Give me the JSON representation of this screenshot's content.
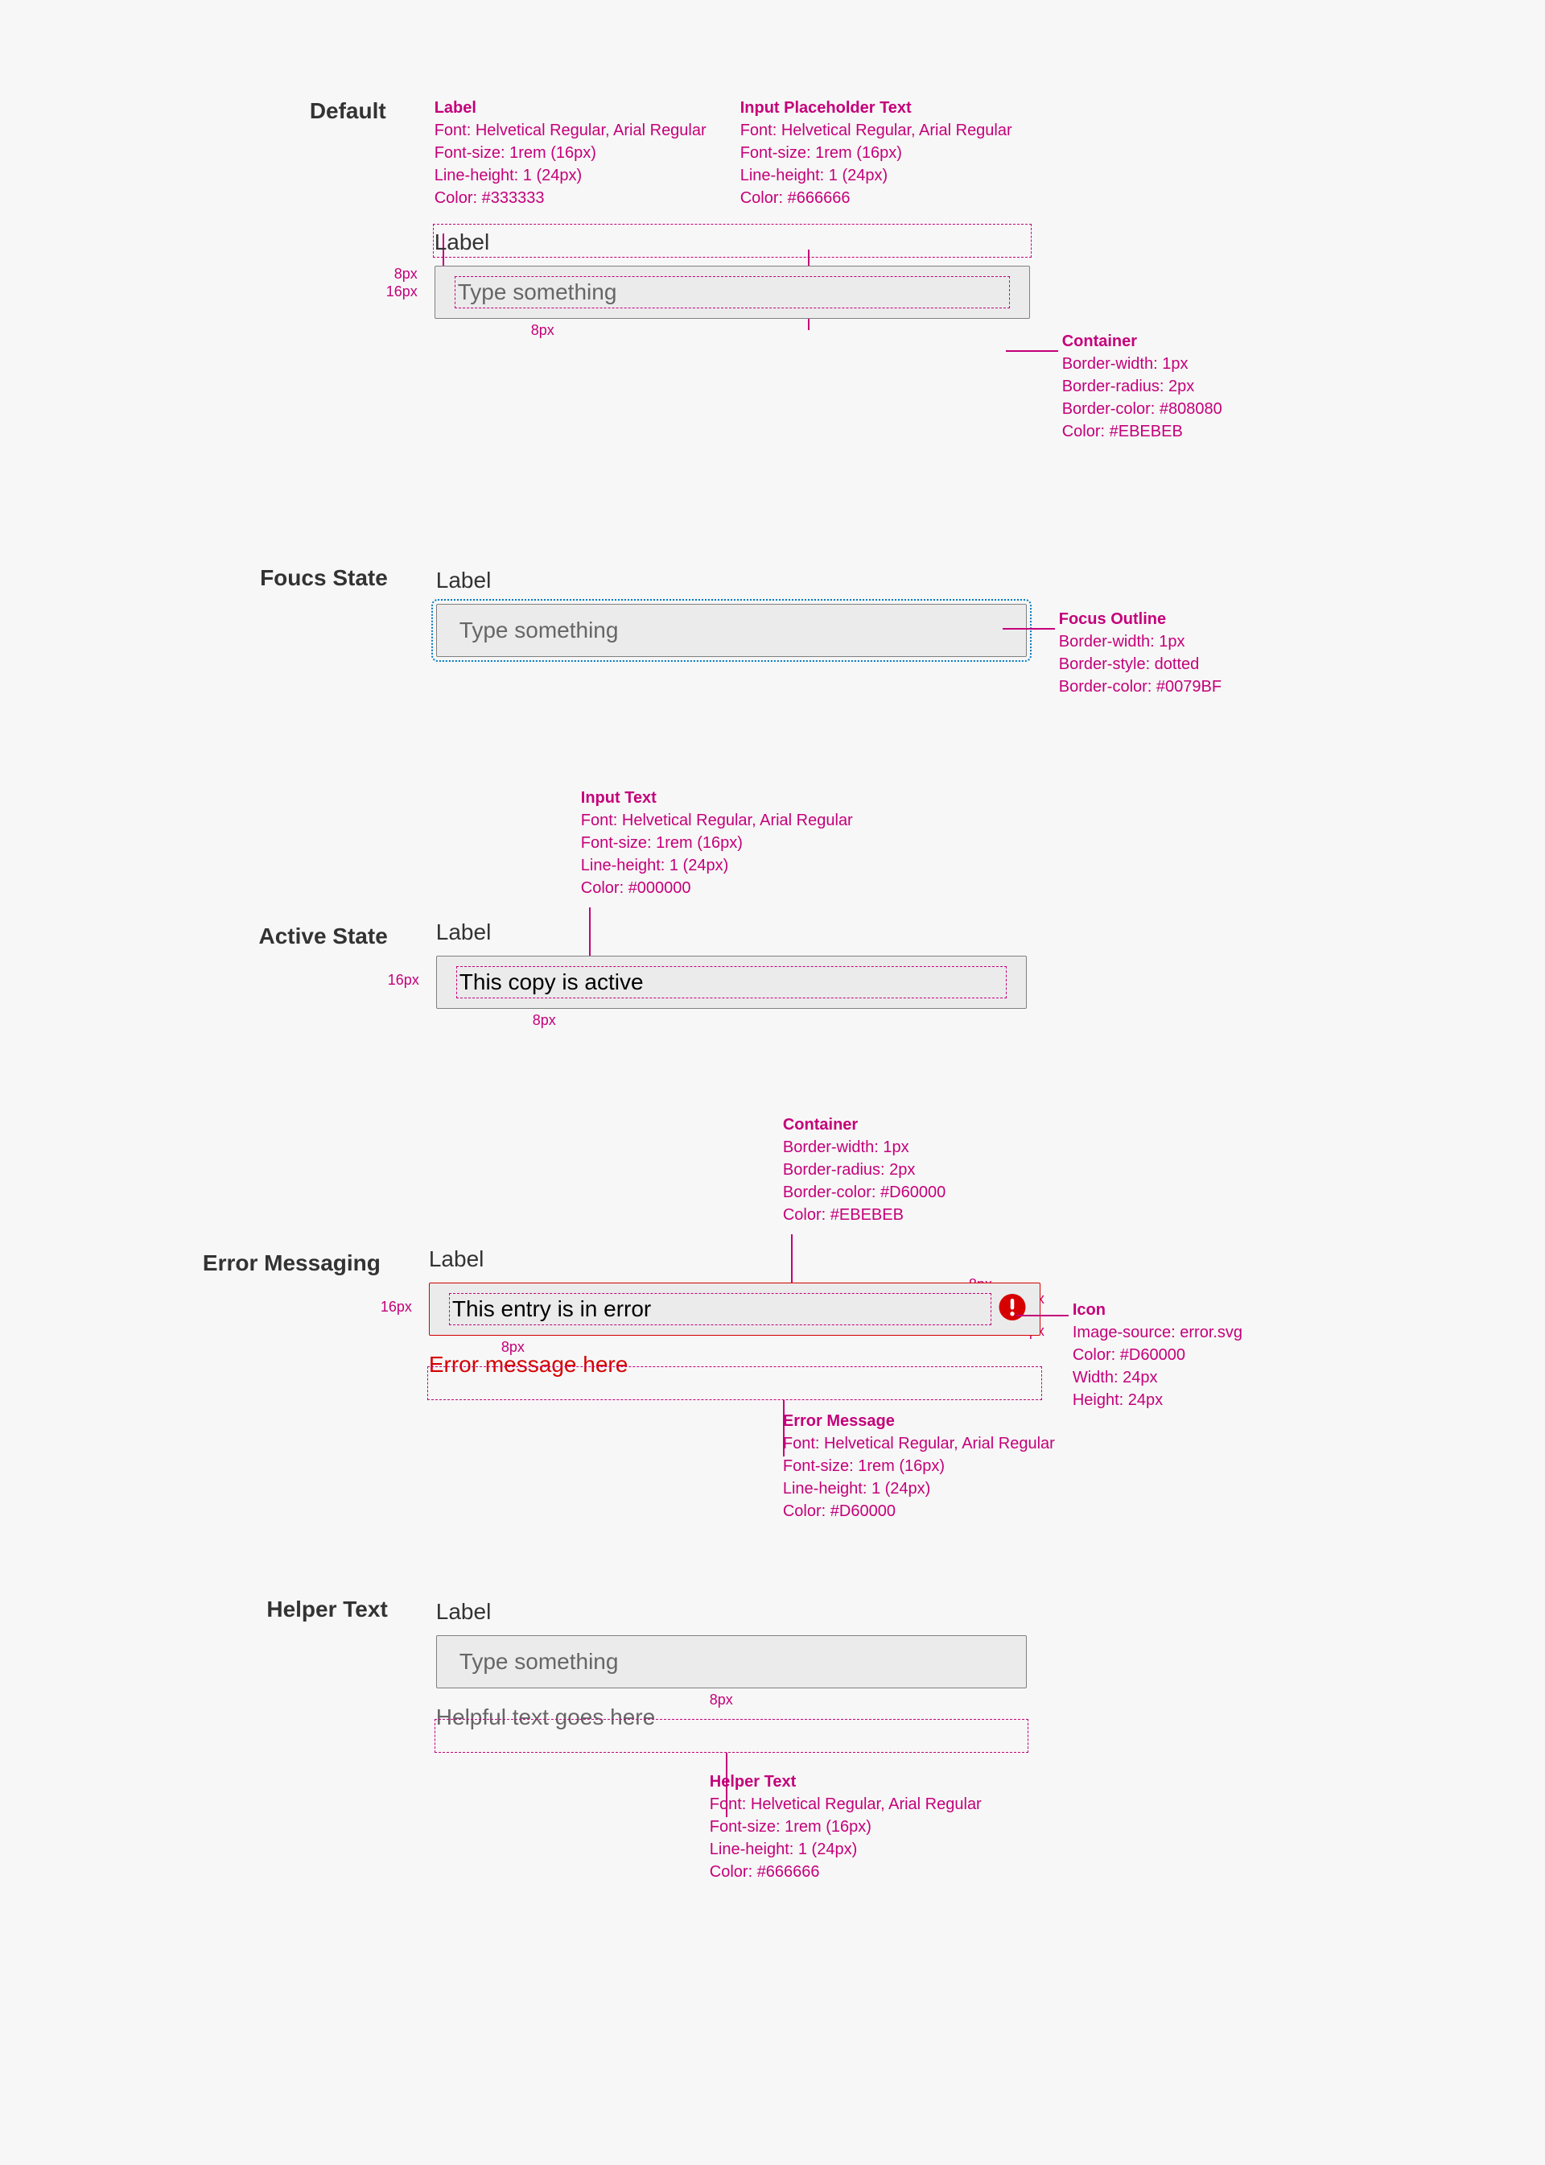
{
  "states": {
    "default": {
      "title": "Default",
      "label": "Label",
      "placeholder": "Type something",
      "callouts": {
        "label": {
          "title": "Label",
          "lines": [
            "Font: Helvetical Regular, Arial Regular",
            "Font-size: 1rem (16px)",
            "Line-height: 1 (24px)",
            "Color: #333333"
          ]
        },
        "placeholder": {
          "title": "Input Placeholder Text",
          "lines": [
            "Font: Helvetical Regular, Arial Regular",
            "Font-size: 1rem (16px)",
            "Line-height: 1 (24px)",
            "Color: #666666"
          ]
        },
        "container": {
          "title": "Container",
          "lines": [
            "Border-width: 1px",
            "Border-radius: 2px",
            "Border-color: #808080",
            "Color: #EBEBEB"
          ]
        }
      },
      "redlines": {
        "px8": "8px",
        "px16": "16px"
      }
    },
    "focus": {
      "title": "Foucs State",
      "label": "Label",
      "placeholder": "Type something",
      "callouts": {
        "outline": {
          "title": "Focus Outline",
          "lines": [
            "Border-width: 1px",
            "Border-style: dotted",
            "Border-color: #0079BF"
          ]
        }
      }
    },
    "active": {
      "title": "Active State",
      "label": "Label",
      "value": "This copy is active",
      "callouts": {
        "inputText": {
          "title": "Input Text",
          "lines": [
            "Font: Helvetical Regular, Arial Regular",
            "Font-size: 1rem (16px)",
            "Line-height: 1 (24px)",
            "Color: #000000"
          ]
        }
      },
      "redlines": {
        "px8": "8px",
        "px16": "16px"
      }
    },
    "error": {
      "title": "Error Messaging",
      "label": "Label",
      "value": "This entry is in error",
      "errorMessage": "Error message here",
      "callouts": {
        "container": {
          "title": "Container",
          "lines": [
            "Border-width: 1px",
            "Border-radius: 2px",
            "Border-color: #D60000",
            "Color: #EBEBEB"
          ]
        },
        "icon": {
          "title": "Icon",
          "lines": [
            "Image-source: error.svg",
            "Color: #D60000",
            "Width: 24px",
            "Height: 24px"
          ]
        },
        "errorMessage": {
          "title": "Error Message",
          "lines": [
            "Font: Helvetical Regular, Arial Regular",
            "Font-size: 1rem (16px)",
            "Line-height: 1 (24px)",
            "Color: #D60000"
          ]
        }
      },
      "redlines": {
        "px8": "8px",
        "px16": "16px"
      }
    },
    "helper": {
      "title": "Helper Text",
      "label": "Label",
      "placeholder": "Type something",
      "helperText": "Helpful text goes here",
      "callouts": {
        "helper": {
          "title": "Helper Text",
          "lines": [
            "Font: Helvetical Regular, Arial Regular",
            "Font-size: 1rem (16px)",
            "Line-height: 1 (24px)",
            "Color: #666666"
          ]
        }
      },
      "redlines": {
        "px8": "8px"
      }
    }
  }
}
